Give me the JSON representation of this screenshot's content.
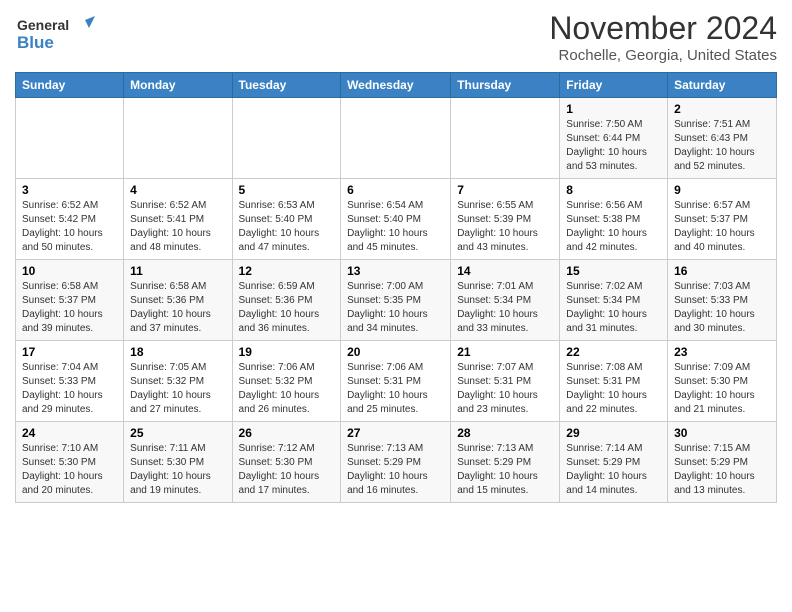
{
  "header": {
    "logo_general": "General",
    "logo_blue": "Blue",
    "title": "November 2024",
    "subtitle": "Rochelle, Georgia, United States"
  },
  "weekdays": [
    "Sunday",
    "Monday",
    "Tuesday",
    "Wednesday",
    "Thursday",
    "Friday",
    "Saturday"
  ],
  "weeks": [
    [
      {
        "day": "",
        "info": ""
      },
      {
        "day": "",
        "info": ""
      },
      {
        "day": "",
        "info": ""
      },
      {
        "day": "",
        "info": ""
      },
      {
        "day": "",
        "info": ""
      },
      {
        "day": "1",
        "info": "Sunrise: 7:50 AM\nSunset: 6:44 PM\nDaylight: 10 hours and 53 minutes."
      },
      {
        "day": "2",
        "info": "Sunrise: 7:51 AM\nSunset: 6:43 PM\nDaylight: 10 hours and 52 minutes."
      }
    ],
    [
      {
        "day": "3",
        "info": "Sunrise: 6:52 AM\nSunset: 5:42 PM\nDaylight: 10 hours and 50 minutes."
      },
      {
        "day": "4",
        "info": "Sunrise: 6:52 AM\nSunset: 5:41 PM\nDaylight: 10 hours and 48 minutes."
      },
      {
        "day": "5",
        "info": "Sunrise: 6:53 AM\nSunset: 5:40 PM\nDaylight: 10 hours and 47 minutes."
      },
      {
        "day": "6",
        "info": "Sunrise: 6:54 AM\nSunset: 5:40 PM\nDaylight: 10 hours and 45 minutes."
      },
      {
        "day": "7",
        "info": "Sunrise: 6:55 AM\nSunset: 5:39 PM\nDaylight: 10 hours and 43 minutes."
      },
      {
        "day": "8",
        "info": "Sunrise: 6:56 AM\nSunset: 5:38 PM\nDaylight: 10 hours and 42 minutes."
      },
      {
        "day": "9",
        "info": "Sunrise: 6:57 AM\nSunset: 5:37 PM\nDaylight: 10 hours and 40 minutes."
      }
    ],
    [
      {
        "day": "10",
        "info": "Sunrise: 6:58 AM\nSunset: 5:37 PM\nDaylight: 10 hours and 39 minutes."
      },
      {
        "day": "11",
        "info": "Sunrise: 6:58 AM\nSunset: 5:36 PM\nDaylight: 10 hours and 37 minutes."
      },
      {
        "day": "12",
        "info": "Sunrise: 6:59 AM\nSunset: 5:36 PM\nDaylight: 10 hours and 36 minutes."
      },
      {
        "day": "13",
        "info": "Sunrise: 7:00 AM\nSunset: 5:35 PM\nDaylight: 10 hours and 34 minutes."
      },
      {
        "day": "14",
        "info": "Sunrise: 7:01 AM\nSunset: 5:34 PM\nDaylight: 10 hours and 33 minutes."
      },
      {
        "day": "15",
        "info": "Sunrise: 7:02 AM\nSunset: 5:34 PM\nDaylight: 10 hours and 31 minutes."
      },
      {
        "day": "16",
        "info": "Sunrise: 7:03 AM\nSunset: 5:33 PM\nDaylight: 10 hours and 30 minutes."
      }
    ],
    [
      {
        "day": "17",
        "info": "Sunrise: 7:04 AM\nSunset: 5:33 PM\nDaylight: 10 hours and 29 minutes."
      },
      {
        "day": "18",
        "info": "Sunrise: 7:05 AM\nSunset: 5:32 PM\nDaylight: 10 hours and 27 minutes."
      },
      {
        "day": "19",
        "info": "Sunrise: 7:06 AM\nSunset: 5:32 PM\nDaylight: 10 hours and 26 minutes."
      },
      {
        "day": "20",
        "info": "Sunrise: 7:06 AM\nSunset: 5:31 PM\nDaylight: 10 hours and 25 minutes."
      },
      {
        "day": "21",
        "info": "Sunrise: 7:07 AM\nSunset: 5:31 PM\nDaylight: 10 hours and 23 minutes."
      },
      {
        "day": "22",
        "info": "Sunrise: 7:08 AM\nSunset: 5:31 PM\nDaylight: 10 hours and 22 minutes."
      },
      {
        "day": "23",
        "info": "Sunrise: 7:09 AM\nSunset: 5:30 PM\nDaylight: 10 hours and 21 minutes."
      }
    ],
    [
      {
        "day": "24",
        "info": "Sunrise: 7:10 AM\nSunset: 5:30 PM\nDaylight: 10 hours and 20 minutes."
      },
      {
        "day": "25",
        "info": "Sunrise: 7:11 AM\nSunset: 5:30 PM\nDaylight: 10 hours and 19 minutes."
      },
      {
        "day": "26",
        "info": "Sunrise: 7:12 AM\nSunset: 5:30 PM\nDaylight: 10 hours and 17 minutes."
      },
      {
        "day": "27",
        "info": "Sunrise: 7:13 AM\nSunset: 5:29 PM\nDaylight: 10 hours and 16 minutes."
      },
      {
        "day": "28",
        "info": "Sunrise: 7:13 AM\nSunset: 5:29 PM\nDaylight: 10 hours and 15 minutes."
      },
      {
        "day": "29",
        "info": "Sunrise: 7:14 AM\nSunset: 5:29 PM\nDaylight: 10 hours and 14 minutes."
      },
      {
        "day": "30",
        "info": "Sunrise: 7:15 AM\nSunset: 5:29 PM\nDaylight: 10 hours and 13 minutes."
      }
    ]
  ]
}
